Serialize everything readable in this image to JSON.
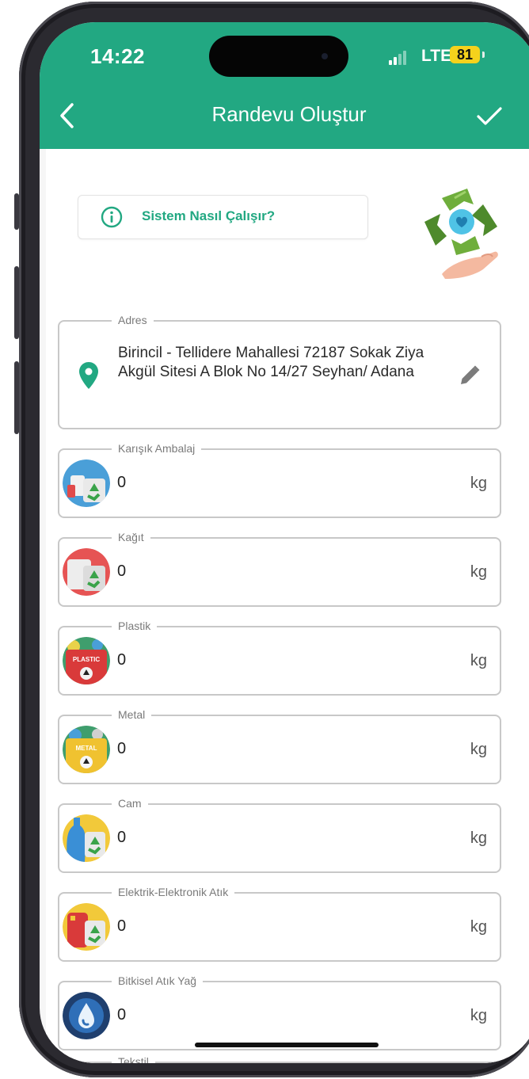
{
  "status_bar": {
    "time": "14:22",
    "network": "LTE",
    "battery": "81"
  },
  "header": {
    "title": "Randevu Oluştur",
    "back_icon": "chevron-left-icon",
    "confirm_icon": "checkmark-icon",
    "color": "#22a882"
  },
  "info_button": {
    "label": "Sistem Nasıl Çalışır?",
    "icon": "info-circle-icon"
  },
  "address": {
    "label": "Adres",
    "value": "Birincil - Tellidere Mahallesi 72187 Sokak Ziya Akgül Sitesi A Blok No 14/27 Seyhan/ Adana",
    "icon": "location-pin-icon",
    "edit_icon": "pencil-icon"
  },
  "waste_items": [
    {
      "label": "Karışık Ambalaj",
      "value": "0",
      "unit": "kg",
      "icon": "mixed-packaging-icon"
    },
    {
      "label": "Kağıt",
      "value": "0",
      "unit": "kg",
      "icon": "paper-icon"
    },
    {
      "label": "Plastik",
      "value": "0",
      "unit": "kg",
      "icon": "plastic-icon",
      "icon_text": "PLASTIC"
    },
    {
      "label": "Metal",
      "value": "0",
      "unit": "kg",
      "icon": "metal-icon",
      "icon_text": "METAL"
    },
    {
      "label": "Cam",
      "value": "0",
      "unit": "kg",
      "icon": "glass-icon"
    },
    {
      "label": "Elektrik-Elektronik Atık",
      "value": "0",
      "unit": "kg",
      "icon": "electronic-waste-icon"
    },
    {
      "label": "Bitkisel Atık Yağ",
      "value": "0",
      "unit": "kg",
      "icon": "vegetable-oil-icon"
    },
    {
      "label": "Tekstil"
    }
  ]
}
